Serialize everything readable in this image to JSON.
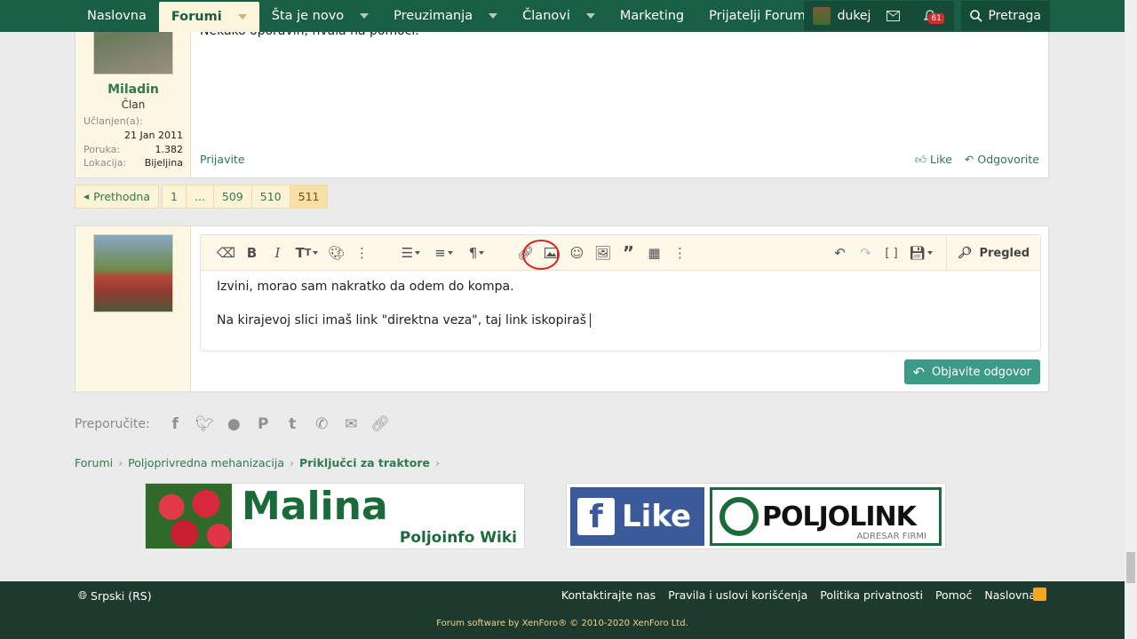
{
  "nav": {
    "tabs": [
      {
        "label": "Naslovna"
      },
      {
        "label": "Forumi"
      },
      {
        "label": "Šta je novo"
      },
      {
        "label": "Preuzimanja"
      },
      {
        "label": "Članovi"
      },
      {
        "label": "Marketing"
      },
      {
        "label": "Prijatelji Foruma"
      }
    ],
    "username": "dukej",
    "alerts_count": "61",
    "search_label": "Pretraga"
  },
  "post": {
    "author": "Miladin",
    "role": "Član",
    "joined_label": "Učlanjen(a):",
    "joined_value": "21 Jan 2011",
    "posts_label": "Poruka:",
    "posts_value": "1.382",
    "location_label": "Lokacija:",
    "location_value": "Bijeljina",
    "text": "Nekako oporavih, hvala na pomoći.",
    "report": "Prijavite",
    "like": "Like",
    "reply": "Odgovorite"
  },
  "pagination": {
    "prev": "Prethodna",
    "pages": [
      "1",
      "...",
      "509",
      "510",
      "511"
    ],
    "current": "511"
  },
  "editor": {
    "line1": "Izvini, morao sam nakratko da odem do kompa.",
    "line2": "Na kirajevoj slici imaš link \"direktna veza\", taj link iskopiraš",
    "preview": "Pregled",
    "submit": "Objavite odgovor"
  },
  "share": {
    "label": "Preporučite:"
  },
  "breadcrumb": [
    "Forumi",
    "Poljoprivredna mehanizacija",
    "Priključci za traktore"
  ],
  "banners": {
    "b1_title": "Malina",
    "b1_sub": "Poljoinfo Wiki",
    "b2_like": "Like",
    "b2_title": "POLJOLINK",
    "b2_sub": "ADRESAR FIRMI"
  },
  "footer": {
    "language": "Srpski (RS)",
    "links": [
      "Kontaktirajte nas",
      "Pravila i uslovi korišćenja",
      "Politika privatnosti",
      "Pomoć",
      "Naslovna"
    ],
    "copyright": "Forum software by XenForo® © 2010-2020 XenForo Ltd."
  },
  "colors": {
    "nav_bg": "#195f45",
    "sidebar_bg": "#fdf7e3",
    "accent": "#2f7a4e",
    "button": "#3c9a86",
    "footer_bg": "#1e3a2e"
  }
}
